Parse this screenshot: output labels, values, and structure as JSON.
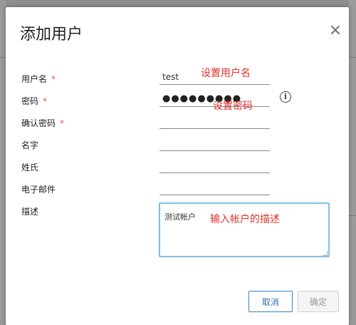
{
  "dialog": {
    "title": "添加用户",
    "close_symbol": "×",
    "fields": {
      "username": {
        "label": "用户名",
        "required_mark": "*",
        "value": "test"
      },
      "password": {
        "label": "密码",
        "required_mark": "*",
        "value": "●●●●●●●●●"
      },
      "confirm_password": {
        "label": "确认密码",
        "required_mark": "*",
        "value": ""
      },
      "first_name": {
        "label": "名字",
        "value": ""
      },
      "last_name": {
        "label": "姓氏",
        "value": ""
      },
      "email": {
        "label": "电子邮件",
        "value": ""
      },
      "description": {
        "label": "描述",
        "value": "测试帐户"
      }
    },
    "info_icon_glyph": "i",
    "buttons": {
      "cancel": "取消",
      "ok": "确定"
    }
  },
  "annotations": {
    "username_note": "设置用户名",
    "password_note": "设置密码",
    "description_note": "输入帐户的描述"
  },
  "icons": {
    "close": "close-icon",
    "info": "info-icon",
    "resize": "resize-grip-icon"
  },
  "colors": {
    "accent_border": "#7fbfe8",
    "annotation": "#e0322d",
    "required": "#d9534f",
    "primary_button_border": "#3a7fc1"
  }
}
